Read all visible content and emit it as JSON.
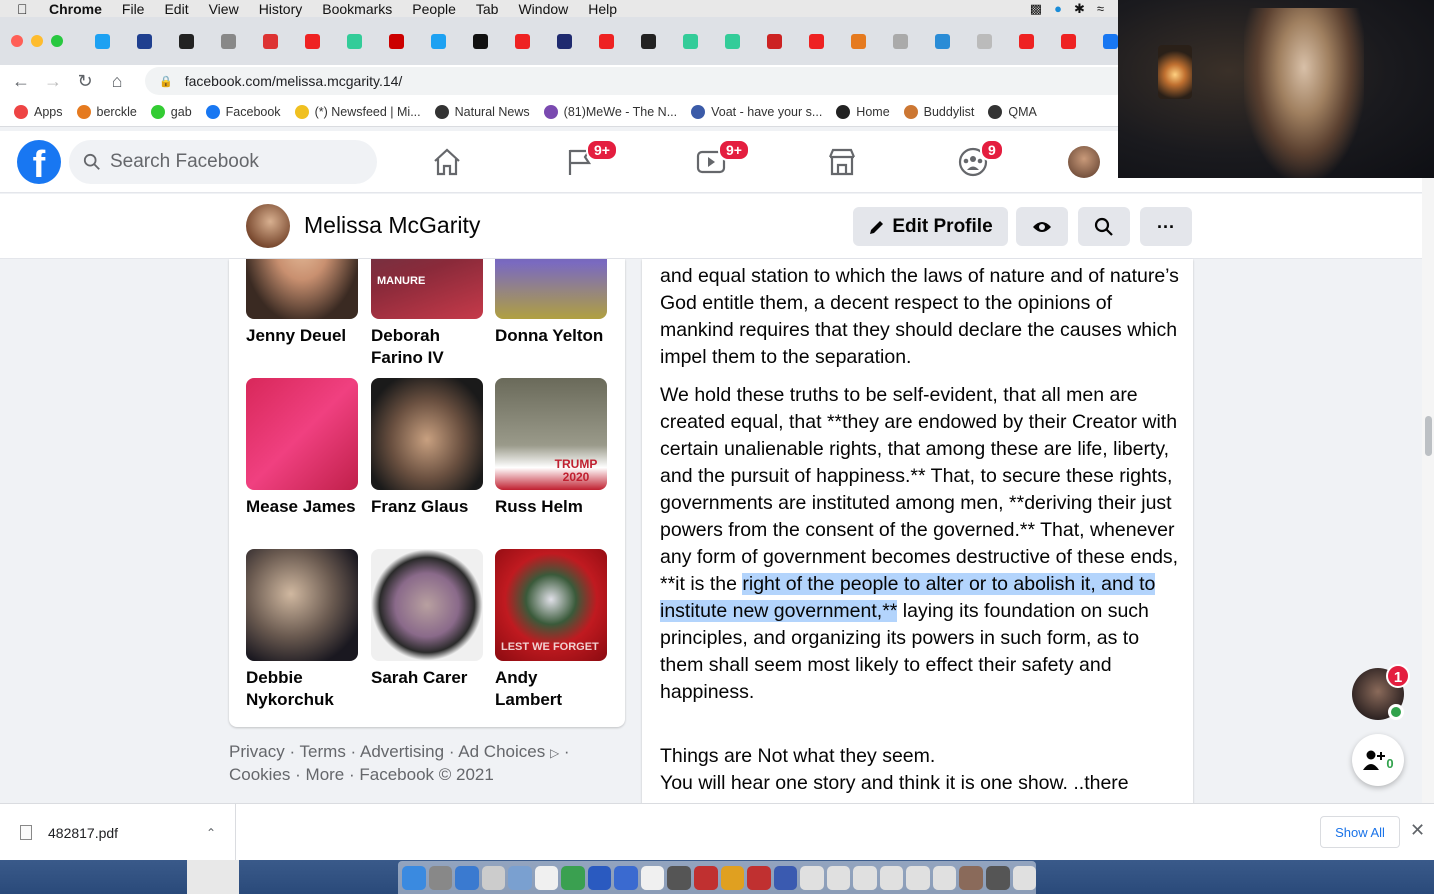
{
  "menubar": {
    "app": "Chrome",
    "items": [
      "File",
      "Edit",
      "View",
      "History",
      "Bookmarks",
      "People",
      "Tab",
      "Window",
      "Help"
    ]
  },
  "tabs": {
    "favicon_colors": [
      "#1da1f2",
      "#1f3f8f",
      "#222222",
      "#888888",
      "#d33",
      "#e22",
      "#3c9",
      "#c00",
      "#1da1f2",
      "#111111",
      "#e22",
      "#1f2a6f",
      "#e22",
      "#222222",
      "#3c9",
      "#3c9",
      "#c22",
      "#e22",
      "#e57a1f",
      "#aaa",
      "#2a8cd6",
      "#bbb",
      "#e22",
      "#e22",
      "#1877f2"
    ]
  },
  "address": {
    "url": "facebook.com/melissa.mcgarity.14/"
  },
  "bookmarks": [
    {
      "label": "Apps",
      "color": "#e44"
    },
    {
      "label": "berckle",
      "color": "#e57a1f"
    },
    {
      "label": "gab",
      "color": "#3c3"
    },
    {
      "label": "Facebook",
      "color": "#1877f2"
    },
    {
      "label": "(*) Newsfeed | Mi...",
      "color": "#f0c020"
    },
    {
      "label": "Natural News",
      "color": "#333333"
    },
    {
      "label": "(81)MeWe - The N...",
      "color": "#7a4ab0"
    },
    {
      "label": "Voat - have your s...",
      "color": "#3b5ba8"
    },
    {
      "label": "Home",
      "color": "#222222"
    },
    {
      "label": "Buddylist",
      "color": "#c73"
    },
    {
      "label": "QMA",
      "color": "#333333"
    }
  ],
  "fbnav": {
    "search_placeholder": "Search Facebook",
    "badges": {
      "pages": "9+",
      "watch": "9+",
      "groups": "9"
    }
  },
  "profile": {
    "name": "Melissa McGarity",
    "edit_label": "Edit Profile"
  },
  "friends": [
    {
      "name": "Jenny Deuel",
      "photo_text": ""
    },
    {
      "name": "Deborah Farino IV",
      "photo_text": "MANURE"
    },
    {
      "name": "Donna Yelton",
      "photo_text": ""
    },
    {
      "name": "Mease James",
      "photo_text": ""
    },
    {
      "name": "Franz Glaus",
      "photo_text": ""
    },
    {
      "name": "Russ Helm",
      "photo_text": "TRUMP 2020"
    },
    {
      "name": "Debbie Nykorchuk",
      "photo_text": ""
    },
    {
      "name": "Sarah Carer",
      "photo_text": ""
    },
    {
      "name": "Andy Lambert",
      "photo_text": "LEST WE FORGET"
    }
  ],
  "footer": {
    "links": [
      "Privacy",
      "Terms",
      "Advertising",
      "Ad Choices",
      "Cookies",
      "More"
    ],
    "copyright": "Facebook © 2021"
  },
  "post": {
    "p1": "and equal station to which the laws of nature and of nature’s God entitle them, a decent respect to the opinions of mankind requires that they should declare the causes which impel them to the separation.",
    "p2_before": "We hold these truths to be self-evident, that all men are created equal, that **they are endowed by their Creator with certain unalienable rights, that among these are life, liberty, and the pursuit of happiness.** That, to secure these rights, governments are instituted among men, **deriving their just powers from the consent of the governed.** That, whenever any form of government becomes destructive of these ends, **it is the ",
    "p2_selected": "right of the people to alter or to abolish it, and to institute new government,**",
    "p2_after": " laying its foundation on such principles, and organizing its powers in such form, as to them shall seem most likely to effect their safety and happiness.",
    "p3_line1": "Things are Not what they seem.",
    "p3_line2": "You will hear one story and think it is one show. ..there"
  },
  "chat": {
    "badge": "1",
    "group_count": "0"
  },
  "downloads": {
    "file": "482817.pdf",
    "show_all": "Show All"
  }
}
